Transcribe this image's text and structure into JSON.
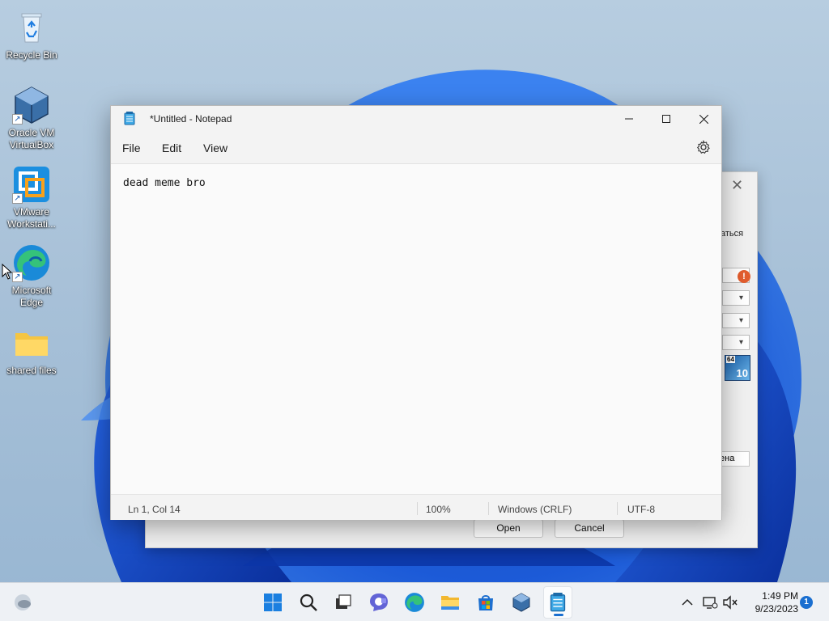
{
  "desktop": {
    "icons": [
      {
        "label": "Recycle Bin"
      },
      {
        "label": "Oracle VM VirtualBox"
      },
      {
        "label": "VMware Workstati..."
      },
      {
        "label": "Microsoft Edge"
      },
      {
        "label": "shared files"
      }
    ]
  },
  "background_dialog": {
    "partial_text": "аться",
    "partial_button": "ена",
    "arch_badge": "64",
    "os_version_badge": "10",
    "open_label": "Open",
    "cancel_label": "Cancel"
  },
  "notepad": {
    "title": "*Untitled - Notepad",
    "menu": {
      "file": "File",
      "edit": "Edit",
      "view": "View"
    },
    "content": "dead meme bro",
    "status": {
      "position": "Ln 1, Col 14",
      "zoom": "100%",
      "line_ending": "Windows (CRLF)",
      "encoding": "UTF-8"
    }
  },
  "taskbar": {
    "pinned": [
      "windows-start",
      "search",
      "task-view",
      "teams-chat",
      "edge",
      "file-explorer",
      "microsoft-store",
      "virtualbox",
      "notepad"
    ],
    "active_app": "notepad",
    "clock": {
      "time": "1:49 PM",
      "date": "9/23/2023"
    },
    "notification_count": "1"
  },
  "colors": {
    "accent": "#1a6fd0",
    "wallpaper_blue": "#1656d8"
  }
}
